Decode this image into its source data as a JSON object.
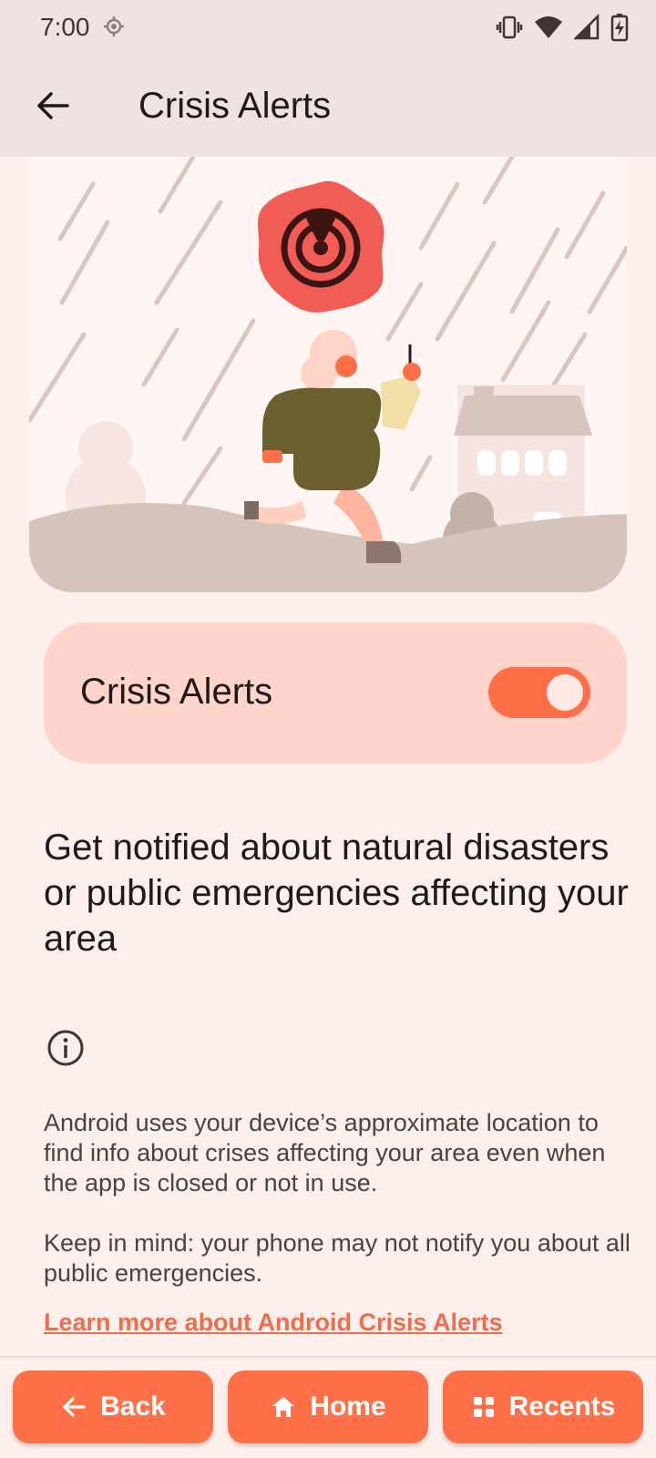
{
  "status_bar": {
    "time": "7:00",
    "icons": [
      "location-icon",
      "vibrate-icon",
      "wifi-icon",
      "signal-icon",
      "battery-charging-icon"
    ]
  },
  "app_bar": {
    "title": "Crisis Alerts",
    "back_icon": "arrow-back-icon"
  },
  "hero": {
    "illustration": "person-walking-in-rain-with-alert-badge"
  },
  "toggle": {
    "label": "Crisis Alerts",
    "enabled": true
  },
  "headline": "Get notified about natural disasters or public emergencies affecting your area",
  "info": {
    "icon": "info-icon",
    "paragraph1": "Android uses your device’s approximate location to find info about crises affecting your area even when the app is closed or not in use.",
    "paragraph2": "Keep in mind: your phone may not notify you about all public emergencies.",
    "link": "Learn more about Android Crisis Alerts"
  },
  "nav": {
    "back_label": "Back",
    "home_label": "Home",
    "recents_label": "Recents"
  },
  "colors": {
    "background": "#fcefec",
    "bar": "#efe3e1",
    "accent": "#ff7049",
    "card": "#ffd4ca",
    "link": "#f06d4c"
  }
}
